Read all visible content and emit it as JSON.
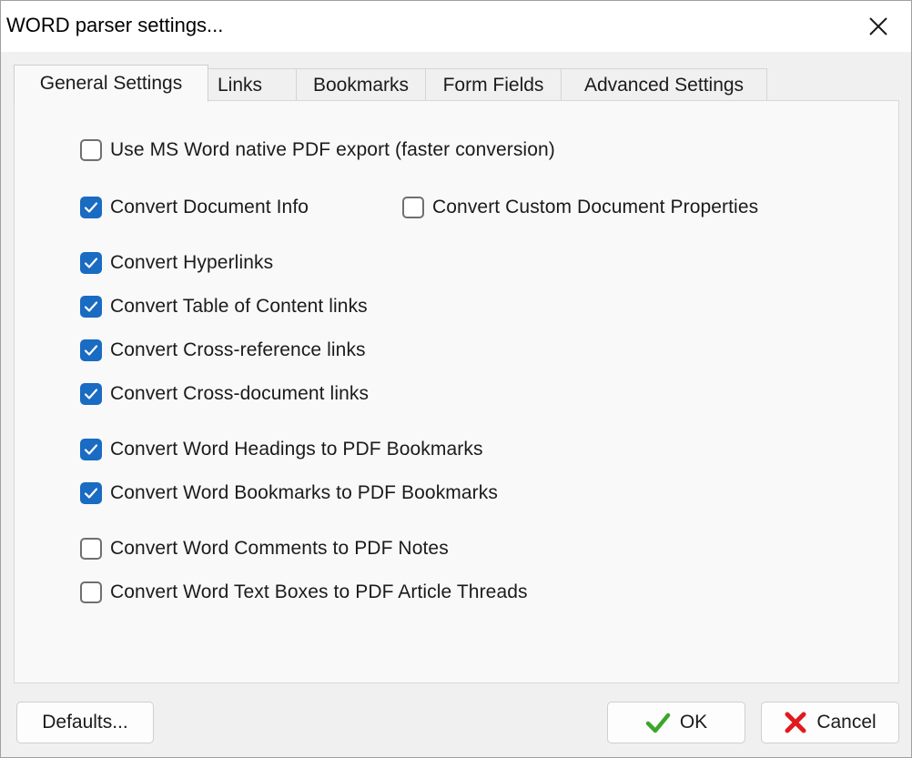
{
  "window": {
    "title": "WORD parser settings..."
  },
  "tabs": [
    {
      "label": "General Settings",
      "active": true
    },
    {
      "label": "Links",
      "active": false
    },
    {
      "label": "Bookmarks",
      "active": false
    },
    {
      "label": "Form Fields",
      "active": false
    },
    {
      "label": "Advanced Settings",
      "active": false
    }
  ],
  "options": {
    "native_export": {
      "label": "Use MS Word native PDF export (faster conversion)",
      "checked": false
    },
    "doc_info": {
      "label": "Convert Document Info",
      "checked": true
    },
    "custom_props": {
      "label": "Convert Custom Document Properties",
      "checked": false
    },
    "hyperlinks": {
      "label": "Convert Hyperlinks",
      "checked": true
    },
    "toc_links": {
      "label": "Convert Table of Content links",
      "checked": true
    },
    "crossref_links": {
      "label": "Convert Cross-reference links",
      "checked": true
    },
    "crossdoc_links": {
      "label": "Convert Cross-document links",
      "checked": true
    },
    "headings_bookmarks": {
      "label": "Convert Word Headings to PDF Bookmarks",
      "checked": true
    },
    "word_bookmarks": {
      "label": "Convert Word Bookmarks to PDF Bookmarks",
      "checked": true
    },
    "comments_notes": {
      "label": "Convert Word Comments to PDF Notes",
      "checked": false
    },
    "textboxes_threads": {
      "label": "Convert Word Text Boxes to PDF Article Threads",
      "checked": false
    }
  },
  "buttons": {
    "defaults": "Defaults...",
    "ok": "OK",
    "cancel": "Cancel"
  },
  "icons": {
    "ok": "checkmark-icon",
    "cancel": "red-x-icon",
    "close": "close-icon"
  },
  "colors": {
    "checkbox_checked": "#1a6bc2",
    "ok_icon": "#3aa629",
    "cancel_icon": "#e01b1b"
  }
}
